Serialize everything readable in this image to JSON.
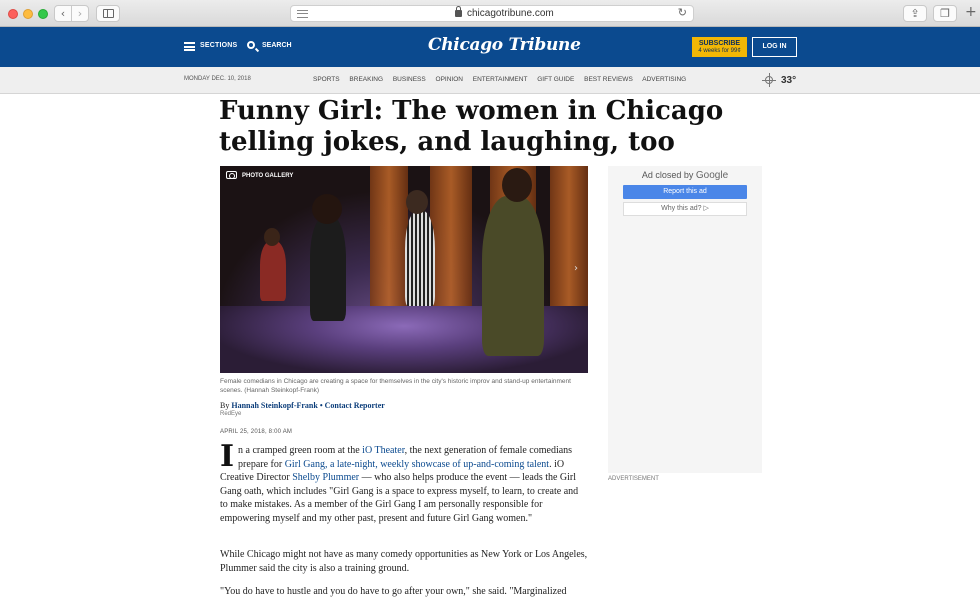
{
  "browser": {
    "url": "chicagotribune.com"
  },
  "header": {
    "sections_label": "SECTIONS",
    "search_label": "SEARCH",
    "logo": "Chicago Tribune",
    "subscribe_line1": "SUBSCRIBE",
    "subscribe_line2": "4 weeks for 99¢",
    "login_label": "LOG IN",
    "brand_color": "#0b4a8f"
  },
  "subnav": {
    "date": "MONDAY DEC. 10, 2018",
    "links": [
      "SPORTS",
      "BREAKING",
      "BUSINESS",
      "OPINION",
      "ENTERTAINMENT",
      "GIFT GUIDE",
      "BEST REVIEWS",
      "ADVERTISING"
    ],
    "temperature": "33°"
  },
  "article": {
    "headline": "Funny Girl: The women in Chicago telling jokes, and laughing, too",
    "photo_gallery_label": "PHOTO GALLERY",
    "caption": "Female comedians in Chicago are creating a space for themselves in the city's historic improv and stand-up entertainment scenes. (Hannah Steinkopf-Frank)",
    "byline_prefix": "By",
    "author": "Hannah Steinkopf-Frank",
    "author_role": "Contact Reporter",
    "outlet": "RedEye",
    "pubdate": "APRIL 25, 2018, 8:00 AM",
    "p1": {
      "dropcap": "I",
      "t1": "n a cramped green room at the ",
      "link1": "iO Theater",
      "t2": ", the next generation of female comedians prepare for ",
      "link2": "Girl Gang, a late-night, weekly showcase of up-and-coming talent",
      "t3": ". iO Creative Director ",
      "link3": "Shelby Plummer",
      "t4": " — who also helps produce the event — leads the Girl Gang oath, which includes \"Girl Gang is a space to express myself, to learn, to create and to make mistakes. As a member of the Girl Gang I am personally responsible for empowering myself and my other past, present and future Girl Gang women.\""
    },
    "p2": "While Chicago might not have as many comedy opportunities as New York or Los Angeles, Plummer said the city is also a training ground.",
    "p3": "\"You do have to hustle and you do have to go after your own,\" she said. \"Marginalized"
  },
  "ad": {
    "closed_by": "Ad closed by",
    "google": "Google",
    "report_label": "Report this ad",
    "why_label": "Why this ad? ▷",
    "advertisement_label": "ADVERTISEMENT"
  }
}
